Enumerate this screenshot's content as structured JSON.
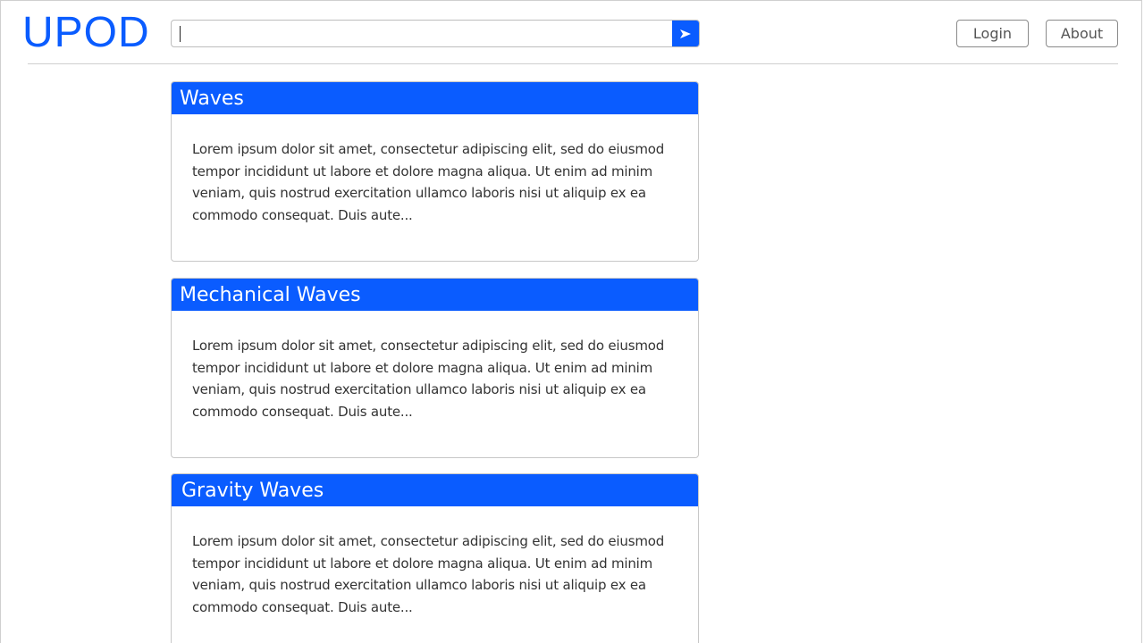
{
  "header": {
    "logo": "UPOD",
    "search": {
      "value": "",
      "placeholder": ""
    },
    "search_button_icon": "send-arrow-icon",
    "login_label": "Login",
    "about_label": "About"
  },
  "colors": {
    "accent": "#0a5cff"
  },
  "cards": [
    {
      "title": "Waves",
      "excerpt": "Lorem ipsum dolor sit amet, consectetur adipiscing elit, sed do eiusmod tempor incididunt ut labore et dolore magna aliqua. Ut enim ad minim veniam, quis nostrud exercitation ullamco laboris nisi ut aliquip ex ea commodo consequat. Duis aute..."
    },
    {
      "title": "Mechanical Waves",
      "excerpt": "Lorem ipsum dolor sit amet, consectetur adipiscing elit, sed do eiusmod tempor incididunt ut labore et dolore magna aliqua. Ut enim ad minim veniam, quis nostrud exercitation ullamco laboris nisi ut aliquip ex ea commodo consequat. Duis aute..."
    },
    {
      "title": "Gravity Waves",
      "excerpt": "Lorem ipsum dolor sit amet, consectetur adipiscing elit, sed do eiusmod tempor incididunt ut labore et dolore magna aliqua. Ut enim ad minim veniam, quis nostrud exercitation ullamco laboris nisi ut aliquip ex ea commodo consequat. Duis aute..."
    }
  ]
}
